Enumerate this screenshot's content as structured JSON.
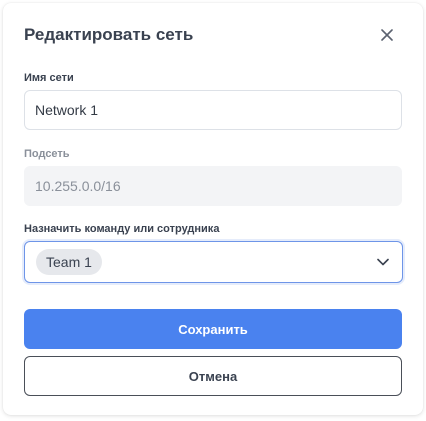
{
  "dialog": {
    "title": "Редактировать сеть",
    "close_icon": "close-icon"
  },
  "form": {
    "network_name": {
      "label": "Имя сети",
      "value": "Network 1"
    },
    "subnet": {
      "label": "Подсеть",
      "value": "10.255.0.0/16"
    },
    "assign": {
      "label": "Назначить команду или сотрудника",
      "selected": [
        "Team 1"
      ],
      "icon": "chevron-down-icon"
    }
  },
  "actions": {
    "save_label": "Сохранить",
    "cancel_label": "Отмена"
  },
  "colors": {
    "primary": "#4a82ef",
    "focus_border": "#6e95e8",
    "chip_bg": "#e6e8ec"
  }
}
